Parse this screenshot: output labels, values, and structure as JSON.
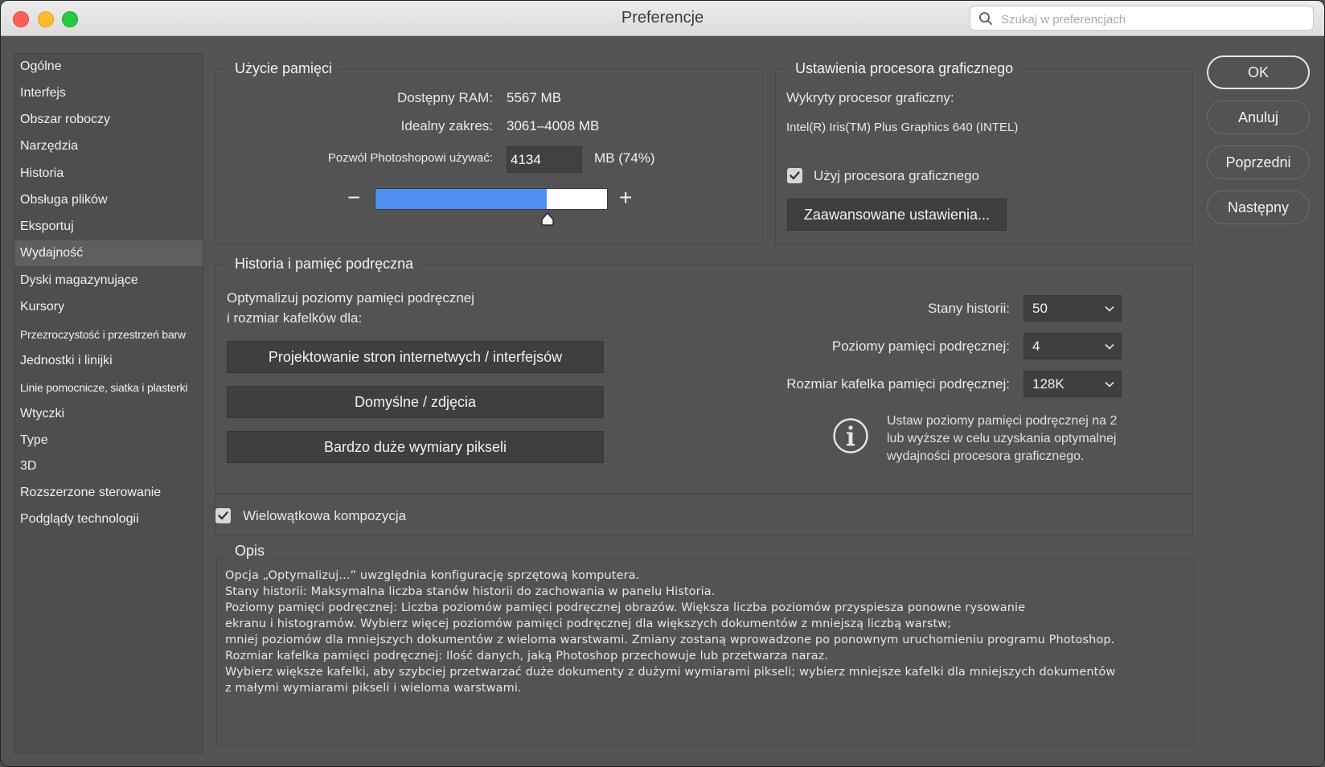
{
  "window": {
    "title": "Preferencje",
    "search_placeholder": "Szukaj w preferencjach"
  },
  "sidebar": {
    "items": [
      {
        "label": "Ogólne"
      },
      {
        "label": "Interfejs"
      },
      {
        "label": "Obszar roboczy"
      },
      {
        "label": "Narzędzia"
      },
      {
        "label": "Historia"
      },
      {
        "label": "Obsługa plików"
      },
      {
        "label": "Eksportuj"
      },
      {
        "label": "Wydajność",
        "selected": true
      },
      {
        "label": "Dyski magazynujące"
      },
      {
        "label": "Kursory"
      },
      {
        "label": "Przezroczystość i przestrzeń barw"
      },
      {
        "label": "Jednostki i linijki"
      },
      {
        "label": "Linie pomocnicze, siatka i plasterki"
      },
      {
        "label": "Wtyczki"
      },
      {
        "label": "Type"
      },
      {
        "label": "3D"
      },
      {
        "label": "Rozszerzone sterowanie"
      },
      {
        "label": "Podglądy technologii"
      }
    ]
  },
  "memory": {
    "title": "Użycie pamięci",
    "ram_label": "Dostępny RAM:",
    "ram_value": "5567 MB",
    "range_label": "Idealny zakres:",
    "range_value": "3061–4008 MB",
    "allow_label": "Pozwól Photoshopowi używać:",
    "allow_value": "4134",
    "allow_suffix": "MB (74%)",
    "slider_fraction": 0.74,
    "minus": "−",
    "plus": "+"
  },
  "gpu": {
    "title": "Ustawienia procesora graficznego",
    "detected_label": "Wykryty procesor graficzny:",
    "detected_value": "Intel(R) Iris(TM) Plus Graphics 640 (INTEL)",
    "use_gpu_label": "Użyj procesora graficznego",
    "use_gpu_checked": true,
    "advanced_button": "Zaawansowane ustawienia..."
  },
  "history": {
    "title": "Historia i pamięć podręczna",
    "optimize_line1": "Optymalizuj poziomy pamięci podręcznej",
    "optimize_line2": "i rozmiar kafelków dla:",
    "btn_web": "Projektowanie stron internetwych / interfejsów",
    "btn_default": "Domyślne / zdjęcia",
    "btn_large": "Bardzo duże wymiary pikseli",
    "states_label": "Stany historii:",
    "states_value": "50",
    "levels_label": "Poziomy pamięci podręcznej:",
    "levels_value": "4",
    "tile_label": "Rozmiar kafelka pamięci podręcznej:",
    "tile_value": "128K",
    "info_line1": "Ustaw poziomy pamięci podręcznej na 2",
    "info_line2": "lub wyższe w celu uzyskania optymalnej",
    "info_line3": "wydajności procesora graficznego."
  },
  "multithread": {
    "label": "Wielowątkowa kompozycja",
    "checked": true
  },
  "description": {
    "title": "Opis",
    "lines": [
      "Opcja „Optymalizuj...” uwzględnia konfigurację sprzętową komputera.",
      "Stany historii: Maksymalna liczba stanów historii do zachowania w panelu Historia.",
      "Poziomy pamięci podręcznej: Liczba poziomów pamięci podręcznej obrazów. Większa liczba poziomów przyspiesza ponowne rysowanie",
      "ekranu i histogramów. Wybierz więcej poziomów pamięci podręcznej dla większych dokumentów z mniejszą liczbą warstw;",
      "mniej poziomów dla mniejszych dokumentów z wieloma warstwami. Zmiany zostaną wprowadzone po ponownym uruchomieniu programu Photoshop.",
      "Rozmiar kafelka pamięci podręcznej: Ilość danych, jaką Photoshop przechowuje lub przetwarza naraz.",
      "Wybierz większe kafelki, aby szybciej przetwarzać duże dokumenty z dużymi wymiarami pikseli; wybierz mniejsze kafelki dla mniejszych dokumentów",
      "z małymi wymiarami pikseli i wieloma warstwami."
    ]
  },
  "buttons": {
    "ok": "OK",
    "cancel": "Anuluj",
    "previous": "Poprzedni",
    "next": "Następny"
  }
}
